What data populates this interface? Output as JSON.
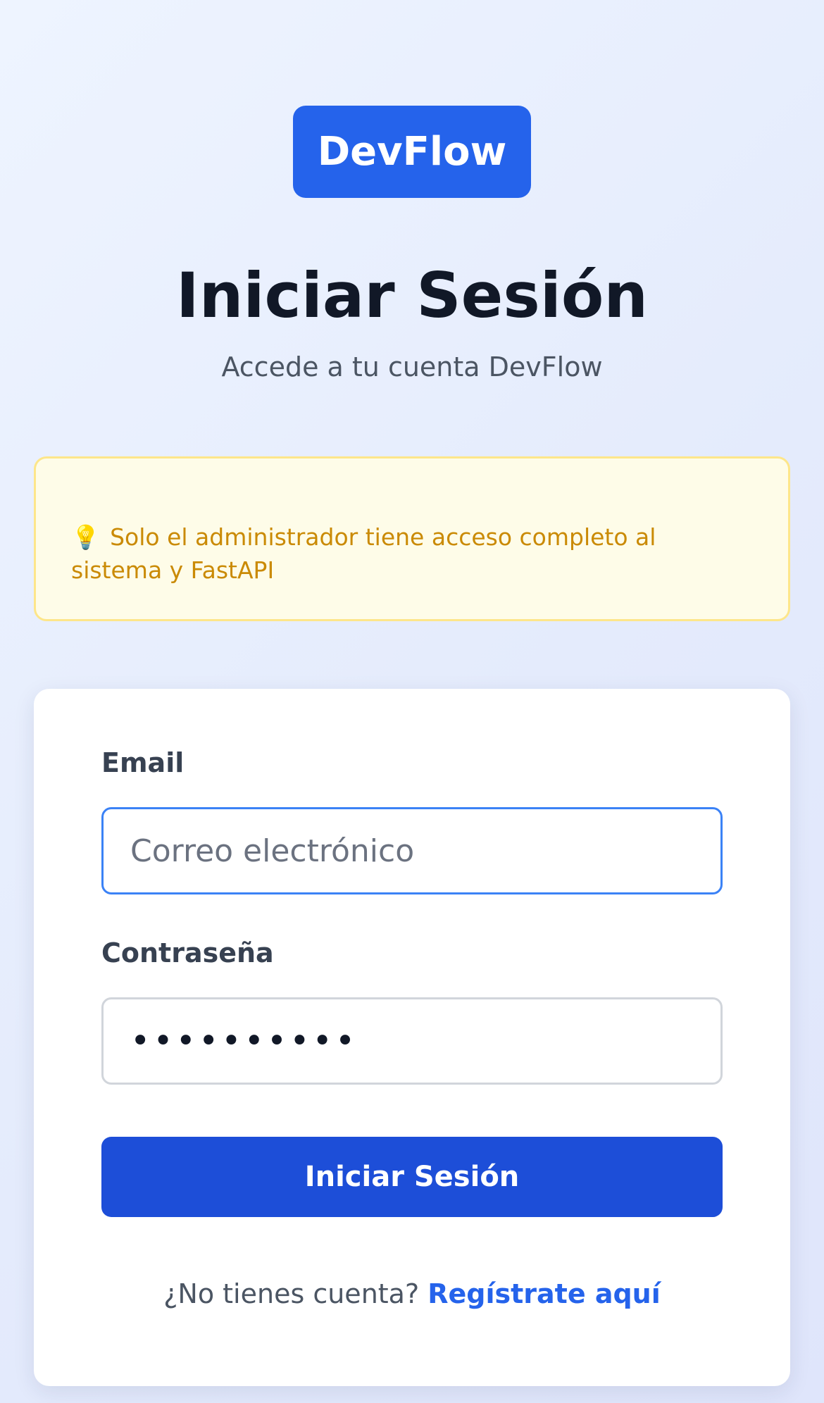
{
  "brand": {
    "logo_text": "DevFlow"
  },
  "header": {
    "title": "Iniciar Sesión",
    "subtitle": "Accede a tu cuenta DevFlow"
  },
  "notice": {
    "icon": "lightbulb-icon",
    "text": "Solo el administrador tiene acceso completo al sistema y FastAPI"
  },
  "form": {
    "email_label": "Email",
    "email_placeholder": "Correo electrónico",
    "email_value": "",
    "password_label": "Contraseña",
    "password_value": "••••••••••",
    "submit_label": "Iniciar Sesión"
  },
  "footer": {
    "prompt": "¿No tienes cuenta?",
    "register_link": "Regístrate aquí"
  },
  "colors": {
    "accent": "#2563eb",
    "button": "#1d4ed8",
    "notice_bg": "#fefce8",
    "notice_text": "#ca8a04"
  }
}
